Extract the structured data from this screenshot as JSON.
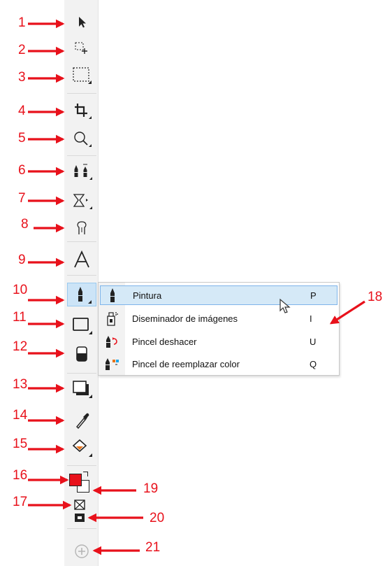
{
  "callouts": [
    "1",
    "2",
    "3",
    "4",
    "5",
    "6",
    "7",
    "8",
    "9",
    "10",
    "11",
    "12",
    "13",
    "14",
    "15",
    "16",
    "17",
    "18",
    "19",
    "20",
    "21"
  ],
  "tools": [
    {
      "name": "pick-tool-icon"
    },
    {
      "name": "freehand-pick-tool-icon"
    },
    {
      "name": "rectangle-mask-tool-icon"
    },
    {
      "name": "crop-tool-icon"
    },
    {
      "name": "zoom-tool-icon"
    },
    {
      "name": "effect-tool-icon"
    },
    {
      "name": "blend-tool-icon"
    },
    {
      "name": "red-eye-tool-icon"
    },
    {
      "name": "text-tool-icon"
    },
    {
      "name": "paint-tool-icon"
    },
    {
      "name": "rectangle-tool-icon"
    },
    {
      "name": "eraser-tool-icon"
    },
    {
      "name": "drop-shadow-tool-icon"
    },
    {
      "name": "eyedropper-tool-icon"
    },
    {
      "name": "fill-tool-icon"
    }
  ],
  "colors": {
    "foreground": "#e8111b",
    "background": "#ffffff",
    "callout": "#e8111b",
    "selection": "#d5e9f7"
  },
  "flyout": {
    "items": [
      {
        "label": "Pintura",
        "shortcut": "P",
        "icon": "paint-brush-icon",
        "selected": true
      },
      {
        "label": "Diseminador de imágenes",
        "shortcut": "I",
        "icon": "image-sprayer-icon",
        "selected": false
      },
      {
        "label": "Pincel deshacer",
        "shortcut": "U",
        "icon": "undo-brush-icon",
        "selected": false
      },
      {
        "label": "Pincel de reemplazar color",
        "shortcut": "Q",
        "icon": "replace-color-brush-icon",
        "selected": false
      }
    ]
  }
}
